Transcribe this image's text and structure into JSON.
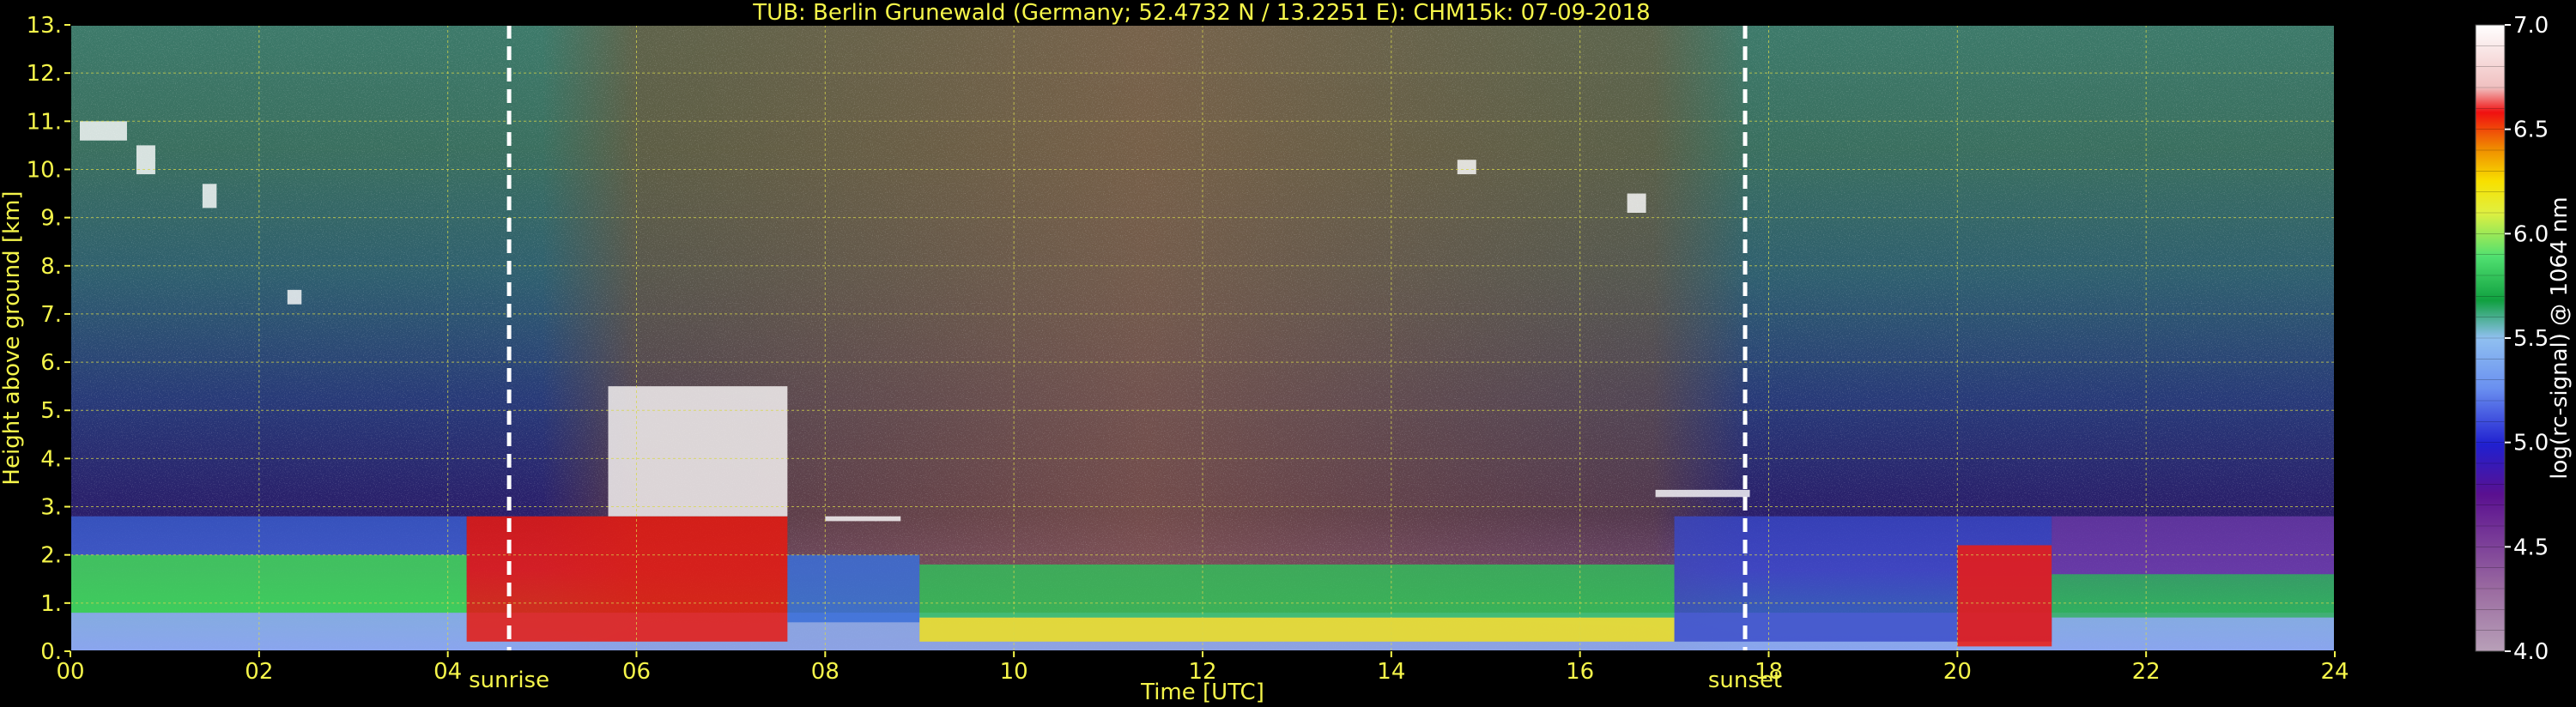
{
  "chart_data": {
    "type": "heatmap",
    "title": "TUB: Berlin Grunewald (Germany; 52.4732 N / 13.2251 E):    CHM15k: 07-09-2018",
    "xlabel": "Time [UTC]",
    "ylabel": "Height above ground [km]",
    "colorbar_label": "log(rc-signal) @ 1064 nm",
    "xlim": [
      0,
      24
    ],
    "ylim": [
      0,
      13
    ],
    "x_ticks": [
      "00",
      "02",
      "04",
      "06",
      "08",
      "10",
      "12",
      "14",
      "16",
      "18",
      "20",
      "22",
      "24"
    ],
    "y_ticks": [
      "0.",
      "1.",
      "2.",
      "3.",
      "4.",
      "5.",
      "6.",
      "7.",
      "8.",
      "9.",
      "10.",
      "11.",
      "12.",
      "13."
    ],
    "colorbar_range": [
      4.0,
      7.0
    ],
    "colorbar_ticks": [
      "4.0",
      "4.5",
      "5.0",
      "5.5",
      "6.0",
      "6.5",
      "7.0"
    ],
    "grid": true,
    "annotations": [
      {
        "label": "sunrise",
        "x": 4.65
      },
      {
        "label": "sunset",
        "x": 17.75
      }
    ],
    "colors": {
      "text": "#f5f54a",
      "background": "#000000",
      "grid": "#d8d84a",
      "sun_lines": "#ffffff"
    }
  }
}
